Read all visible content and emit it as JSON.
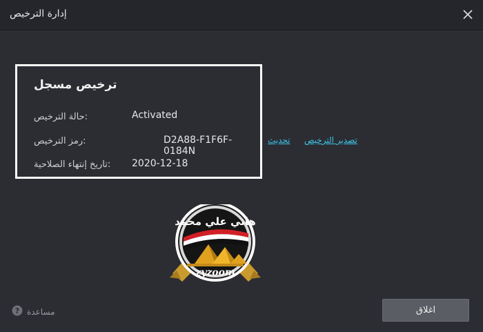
{
  "window": {
    "title": "إدارة الترخيص"
  },
  "license": {
    "heading": "ترخيص مسجل",
    "status_label": "حالة الترخيص:",
    "status_value": "Activated",
    "code_label": "رمز الترخيص:",
    "code_value": "D2A88-F1F6F-0184N",
    "expiry_label": "تاريخ إنتهاء الصلاحية:",
    "expiry_value": "2020-12-18"
  },
  "links": {
    "update": "تحديث",
    "export": "تصدير الترخيص"
  },
  "logo": {
    "top_text": "هاني علي محمد",
    "bottom_text": "zyzoom"
  },
  "footer": {
    "help_label": "مساعدة",
    "close_label": "اغلاق"
  },
  "colors": {
    "background": "#2b2d33",
    "titlebar": "#24262c",
    "link": "#3fc6e8",
    "box_border": "#ffffff"
  }
}
